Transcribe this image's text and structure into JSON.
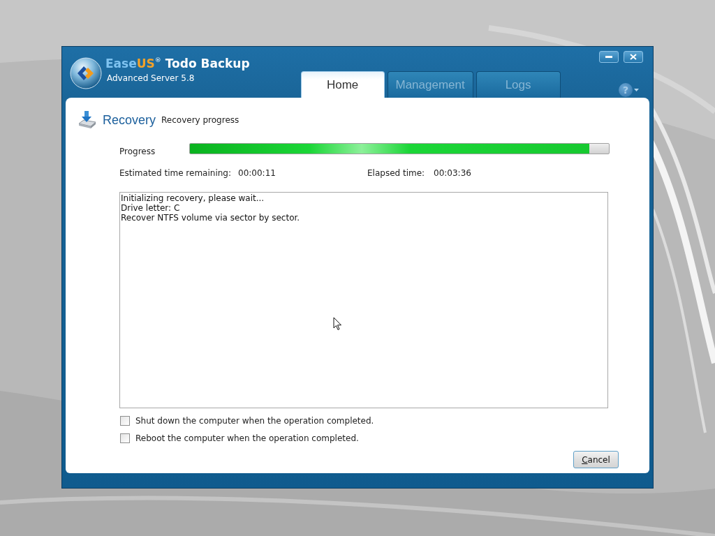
{
  "app": {
    "brand_a": "Ease",
    "brand_b": "US",
    "mark": "®",
    "product": "Todo Backup",
    "edition": "Advanced Server 5.8"
  },
  "tabs": [
    {
      "label": "Home",
      "selected": true
    },
    {
      "label": "Management",
      "selected": false
    },
    {
      "label": "Logs",
      "selected": false
    }
  ],
  "help": {
    "label": "?"
  },
  "section": {
    "title": "Recovery",
    "subtitle": "Recovery progress"
  },
  "progress": {
    "label": "Progress",
    "level": 0.953
  },
  "times": [
    {
      "label": "Estimated time remaining:",
      "value": "00:00:11"
    },
    {
      "label": "Elapsed time:",
      "value": "00:03:36"
    }
  ],
  "log": [
    "Initializing recovery, please wait...",
    "Drive letter: C",
    "Recover NTFS volume via sector by sector."
  ],
  "options": [
    {
      "label": "Shut down the computer when the operation completed.",
      "checked": false
    },
    {
      "label": "Reboot the computer when the operation completed.",
      "checked": false
    }
  ],
  "buttons": [
    {
      "label": "Cancel",
      "access_key": true
    }
  ]
}
